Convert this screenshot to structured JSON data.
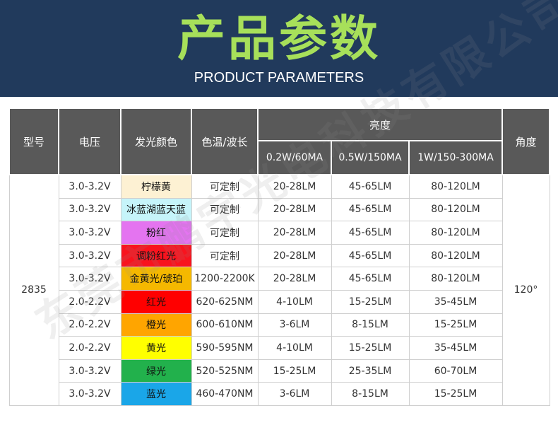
{
  "header": {
    "title": "产品参数",
    "subtitle": "PRODUCT PARAMETERS"
  },
  "colors": {
    "banner_bg": "#213a5c",
    "title_color": "#a7e05a",
    "header_bg": "#595959"
  },
  "table": {
    "headers": {
      "model": "型号",
      "voltage": "电压",
      "color": "发光颜色",
      "temp": "色温/波长",
      "brightness": "亮度",
      "angle": "角度",
      "b1": "0.2W/60MA",
      "b2": "0.5W/150MA",
      "b3": "1W/150-300MA"
    },
    "model_value": "2835",
    "angle_value": "120°",
    "rows": [
      {
        "voltage": "3.0-3.2V",
        "color": "柠檬黄",
        "swatch": "#fdf1d3",
        "temp": "可定制",
        "b1": "20-28LM",
        "b2": "45-65LM",
        "b3": "80-120LM"
      },
      {
        "voltage": "3.0-3.2V",
        "color": "冰蓝湖蓝天蓝",
        "swatch": "#c6f4fa",
        "temp": "可定制",
        "b1": "20-28LM",
        "b2": "45-65LM",
        "b3": "80-120LM"
      },
      {
        "voltage": "3.0-3.2V",
        "color": "粉红",
        "swatch": "#e474f0",
        "temp": "可定制",
        "b1": "20-28LM",
        "b2": "45-65LM",
        "b3": "80-120LM"
      },
      {
        "voltage": "3.0-3.2V",
        "color": "调粉红光",
        "swatch": "#f8131e",
        "temp": "可定制",
        "b1": "20-28LM",
        "b2": "45-65LM",
        "b3": "80-120LM"
      },
      {
        "voltage": "3.0-3.2V",
        "color": "金黄光/琥珀",
        "swatch": "#f5b800",
        "temp": "1200-2200K",
        "b1": "20-28LM",
        "b2": "45-65LM",
        "b3": "80-120LM"
      },
      {
        "voltage": "2.0-2.2V",
        "color": "红光",
        "swatch": "#ff0000",
        "temp": "620-625NM",
        "b1": "4-10LM",
        "b2": "15-25LM",
        "b3": "35-45LM"
      },
      {
        "voltage": "2.0-2.2V",
        "color": "橙光",
        "swatch": "#ffa500",
        "temp": "600-610NM",
        "b1": "3-6LM",
        "b2": "8-15LM",
        "b3": "15-25LM"
      },
      {
        "voltage": "2.0-2.2V",
        "color": "黄光",
        "swatch": "#ffff00",
        "temp": "590-595NM",
        "b1": "4-10LM",
        "b2": "15-25LM",
        "b3": "35-45LM"
      },
      {
        "voltage": "3.0-3.2V",
        "color": "绿光",
        "swatch": "#22b14c",
        "temp": "520-525NM",
        "b1": "15-25LM",
        "b2": "25-35LM",
        "b3": "60-70LM"
      },
      {
        "voltage": "3.0-3.2V",
        "color": "蓝光",
        "swatch": "#1aa6e8",
        "temp": "460-470NM",
        "b1": "3-6LM",
        "b2": "8-15LM",
        "b3": "15-25LM"
      }
    ]
  },
  "watermark": "东莞市鹏宇光电科技有限公司"
}
